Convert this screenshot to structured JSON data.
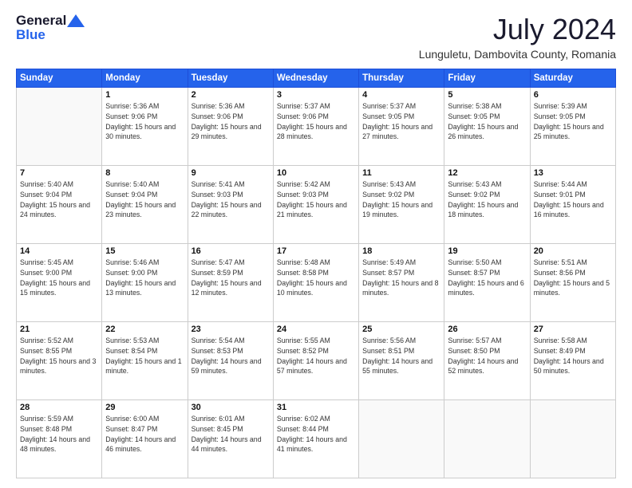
{
  "header": {
    "logo_general": "General",
    "logo_blue": "Blue",
    "month_title": "July 2024",
    "location": "Lunguletu, Dambovita County, Romania"
  },
  "days_of_week": [
    "Sunday",
    "Monday",
    "Tuesday",
    "Wednesday",
    "Thursday",
    "Friday",
    "Saturday"
  ],
  "weeks": [
    [
      {
        "day": "",
        "info": ""
      },
      {
        "day": "1",
        "info": "Sunrise: 5:36 AM\nSunset: 9:06 PM\nDaylight: 15 hours\nand 30 minutes."
      },
      {
        "day": "2",
        "info": "Sunrise: 5:36 AM\nSunset: 9:06 PM\nDaylight: 15 hours\nand 29 minutes."
      },
      {
        "day": "3",
        "info": "Sunrise: 5:37 AM\nSunset: 9:06 PM\nDaylight: 15 hours\nand 28 minutes."
      },
      {
        "day": "4",
        "info": "Sunrise: 5:37 AM\nSunset: 9:05 PM\nDaylight: 15 hours\nand 27 minutes."
      },
      {
        "day": "5",
        "info": "Sunrise: 5:38 AM\nSunset: 9:05 PM\nDaylight: 15 hours\nand 26 minutes."
      },
      {
        "day": "6",
        "info": "Sunrise: 5:39 AM\nSunset: 9:05 PM\nDaylight: 15 hours\nand 25 minutes."
      }
    ],
    [
      {
        "day": "7",
        "info": "Sunrise: 5:40 AM\nSunset: 9:04 PM\nDaylight: 15 hours\nand 24 minutes."
      },
      {
        "day": "8",
        "info": "Sunrise: 5:40 AM\nSunset: 9:04 PM\nDaylight: 15 hours\nand 23 minutes."
      },
      {
        "day": "9",
        "info": "Sunrise: 5:41 AM\nSunset: 9:03 PM\nDaylight: 15 hours\nand 22 minutes."
      },
      {
        "day": "10",
        "info": "Sunrise: 5:42 AM\nSunset: 9:03 PM\nDaylight: 15 hours\nand 21 minutes."
      },
      {
        "day": "11",
        "info": "Sunrise: 5:43 AM\nSunset: 9:02 PM\nDaylight: 15 hours\nand 19 minutes."
      },
      {
        "day": "12",
        "info": "Sunrise: 5:43 AM\nSunset: 9:02 PM\nDaylight: 15 hours\nand 18 minutes."
      },
      {
        "day": "13",
        "info": "Sunrise: 5:44 AM\nSunset: 9:01 PM\nDaylight: 15 hours\nand 16 minutes."
      }
    ],
    [
      {
        "day": "14",
        "info": "Sunrise: 5:45 AM\nSunset: 9:00 PM\nDaylight: 15 hours\nand 15 minutes."
      },
      {
        "day": "15",
        "info": "Sunrise: 5:46 AM\nSunset: 9:00 PM\nDaylight: 15 hours\nand 13 minutes."
      },
      {
        "day": "16",
        "info": "Sunrise: 5:47 AM\nSunset: 8:59 PM\nDaylight: 15 hours\nand 12 minutes."
      },
      {
        "day": "17",
        "info": "Sunrise: 5:48 AM\nSunset: 8:58 PM\nDaylight: 15 hours\nand 10 minutes."
      },
      {
        "day": "18",
        "info": "Sunrise: 5:49 AM\nSunset: 8:57 PM\nDaylight: 15 hours\nand 8 minutes."
      },
      {
        "day": "19",
        "info": "Sunrise: 5:50 AM\nSunset: 8:57 PM\nDaylight: 15 hours\nand 6 minutes."
      },
      {
        "day": "20",
        "info": "Sunrise: 5:51 AM\nSunset: 8:56 PM\nDaylight: 15 hours\nand 5 minutes."
      }
    ],
    [
      {
        "day": "21",
        "info": "Sunrise: 5:52 AM\nSunset: 8:55 PM\nDaylight: 15 hours\nand 3 minutes."
      },
      {
        "day": "22",
        "info": "Sunrise: 5:53 AM\nSunset: 8:54 PM\nDaylight: 15 hours\nand 1 minute."
      },
      {
        "day": "23",
        "info": "Sunrise: 5:54 AM\nSunset: 8:53 PM\nDaylight: 14 hours\nand 59 minutes."
      },
      {
        "day": "24",
        "info": "Sunrise: 5:55 AM\nSunset: 8:52 PM\nDaylight: 14 hours\nand 57 minutes."
      },
      {
        "day": "25",
        "info": "Sunrise: 5:56 AM\nSunset: 8:51 PM\nDaylight: 14 hours\nand 55 minutes."
      },
      {
        "day": "26",
        "info": "Sunrise: 5:57 AM\nSunset: 8:50 PM\nDaylight: 14 hours\nand 52 minutes."
      },
      {
        "day": "27",
        "info": "Sunrise: 5:58 AM\nSunset: 8:49 PM\nDaylight: 14 hours\nand 50 minutes."
      }
    ],
    [
      {
        "day": "28",
        "info": "Sunrise: 5:59 AM\nSunset: 8:48 PM\nDaylight: 14 hours\nand 48 minutes."
      },
      {
        "day": "29",
        "info": "Sunrise: 6:00 AM\nSunset: 8:47 PM\nDaylight: 14 hours\nand 46 minutes."
      },
      {
        "day": "30",
        "info": "Sunrise: 6:01 AM\nSunset: 8:45 PM\nDaylight: 14 hours\nand 44 minutes."
      },
      {
        "day": "31",
        "info": "Sunrise: 6:02 AM\nSunset: 8:44 PM\nDaylight: 14 hours\nand 41 minutes."
      },
      {
        "day": "",
        "info": ""
      },
      {
        "day": "",
        "info": ""
      },
      {
        "day": "",
        "info": ""
      }
    ]
  ]
}
